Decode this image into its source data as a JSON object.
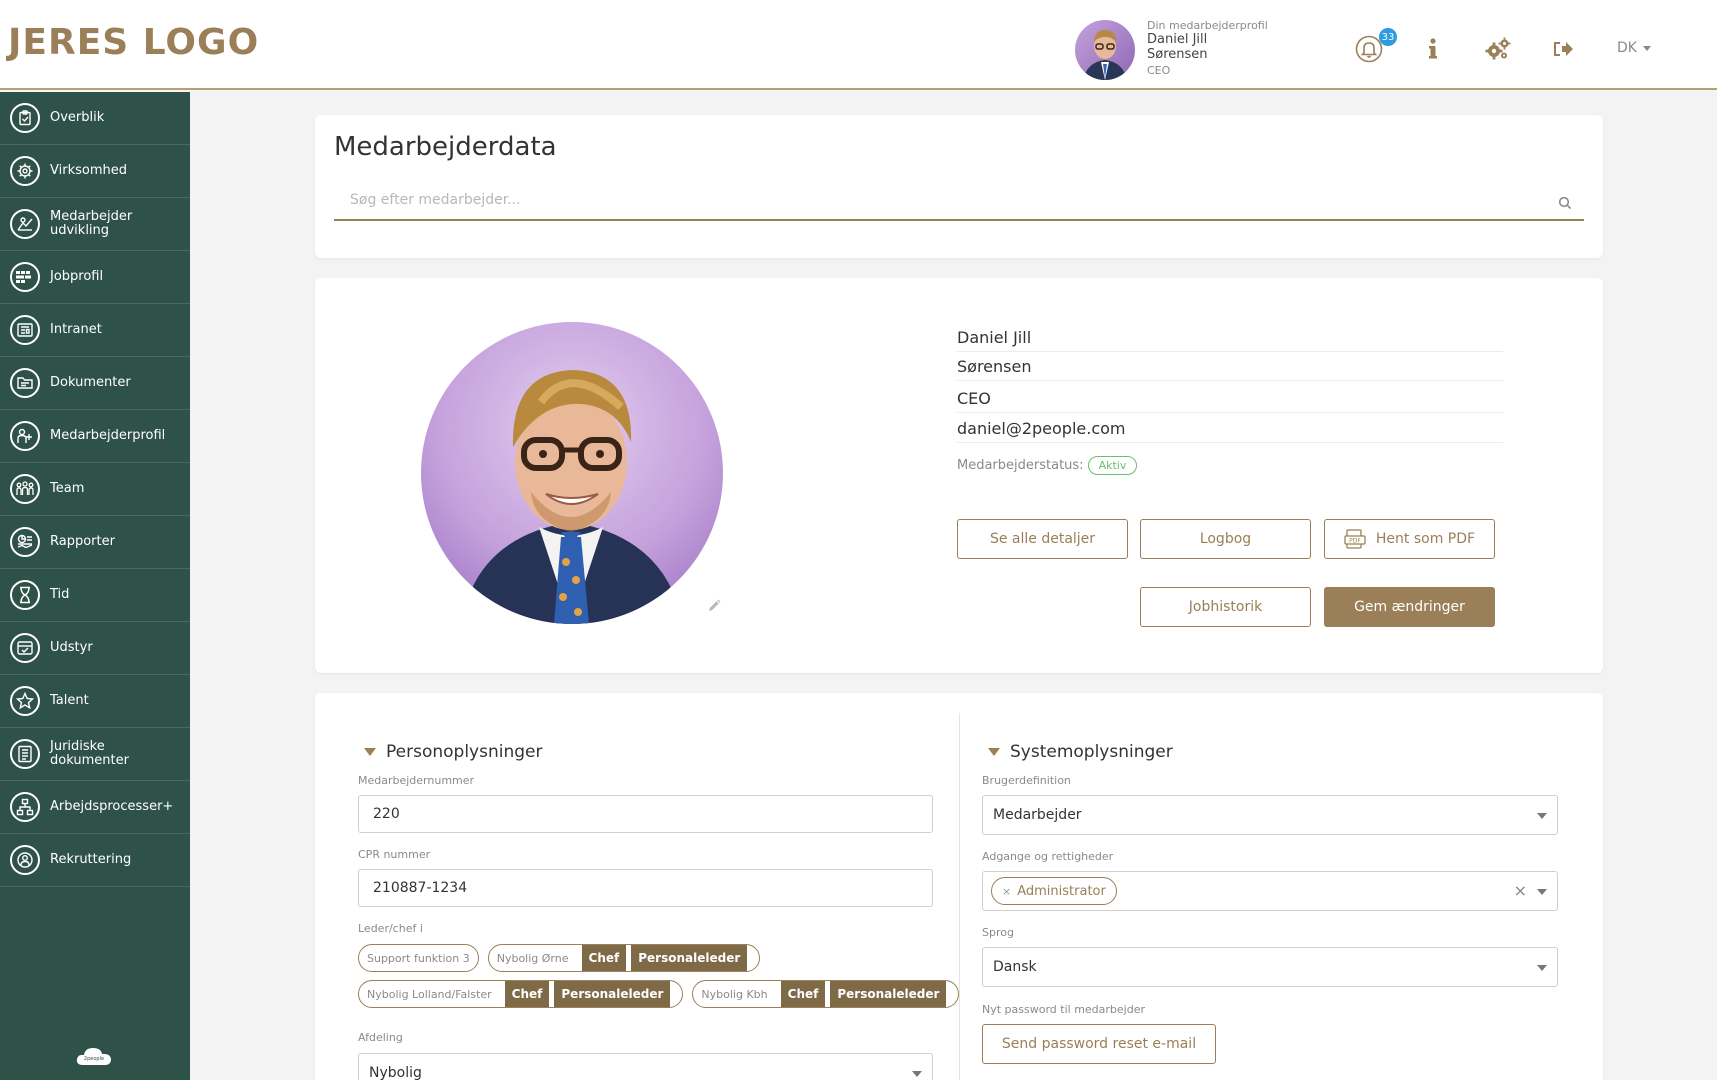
{
  "header": {
    "logo": "JERES LOGO",
    "profile_sub": "Din medarbejderprofil",
    "profile_first": "Daniel Jill",
    "profile_last": "Sørensen",
    "profile_role": "CEO",
    "notification_count": "33",
    "language": "DK"
  },
  "sidebar": {
    "items": [
      {
        "label": "Overblik",
        "icon": "clipboard-icon"
      },
      {
        "label": "Virksomhed",
        "icon": "gear-icon"
      },
      {
        "label": "Medarbejder udvikling",
        "icon": "chart-icon"
      },
      {
        "label": "Jobprofil",
        "icon": "profile-card-icon"
      },
      {
        "label": "Intranet",
        "icon": "newspaper-icon"
      },
      {
        "label": "Dokumenter",
        "icon": "folder-icon"
      },
      {
        "label": "Medarbejderprofil",
        "icon": "user-add-icon"
      },
      {
        "label": "Team",
        "icon": "team-icon"
      },
      {
        "label": "Rapporter",
        "icon": "report-icon"
      },
      {
        "label": "Tid",
        "icon": "hourglass-icon"
      },
      {
        "label": "Udstyr",
        "icon": "box-icon"
      },
      {
        "label": "Talent",
        "icon": "star-icon"
      },
      {
        "label": "Juridiske dokumenter",
        "icon": "document-icon"
      },
      {
        "label": "Arbejdsprocesser+",
        "icon": "workflow-icon"
      },
      {
        "label": "Rekruttering",
        "icon": "recruit-icon"
      }
    ],
    "footer_logo": "2people"
  },
  "search": {
    "title": "Medarbejderdata",
    "placeholder": "Søg efter medarbejder..."
  },
  "profile": {
    "first_name": "Daniel Jill",
    "last_name": "Sørensen",
    "title": "CEO",
    "email": "daniel@2people.com",
    "status_label": "Medarbejderstatus:",
    "status_value": "Aktiv",
    "buttons": {
      "details": "Se alle detaljer",
      "logbook": "Logbog",
      "pdf": "Hent som PDF",
      "job_history": "Jobhistorik",
      "save": "Gem ændringer"
    }
  },
  "personal": {
    "title": "Personoplysninger",
    "employee_number_label": "Medarbejdernummer",
    "employee_number": "220",
    "cpr_label": "CPR nummer",
    "cpr": "210887-1234",
    "leader_label": "Leder/chef i",
    "leader_chips": [
      {
        "name": "Support funktion 3",
        "tags": []
      },
      {
        "name": "Nybolig Ørne",
        "tags": [
          "Chef",
          "Personaleleder"
        ]
      },
      {
        "name": "Nybolig Lolland/Falster",
        "tags": [
          "Chef",
          "Personaleleder"
        ]
      },
      {
        "name": "Nybolig Kbh",
        "tags": [
          "Chef",
          "Personaleleder"
        ]
      }
    ],
    "department_label": "Afdeling",
    "department": "Nybolig"
  },
  "system": {
    "title": "Systemoplysninger",
    "user_def_label": "Brugerdefinition",
    "user_def": "Medarbejder",
    "access_label": "Adgange og rettigheder",
    "access_tag": "Administrator",
    "language_label": "Sprog",
    "language": "Dansk",
    "password_label": "Nyt password til medarbejder",
    "password_button": "Send password reset e-mail"
  },
  "colors": {
    "accent": "#9a7f58",
    "sidebar": "#2e5148",
    "status": "#6cbf6c",
    "badge": "#2d9be0"
  }
}
